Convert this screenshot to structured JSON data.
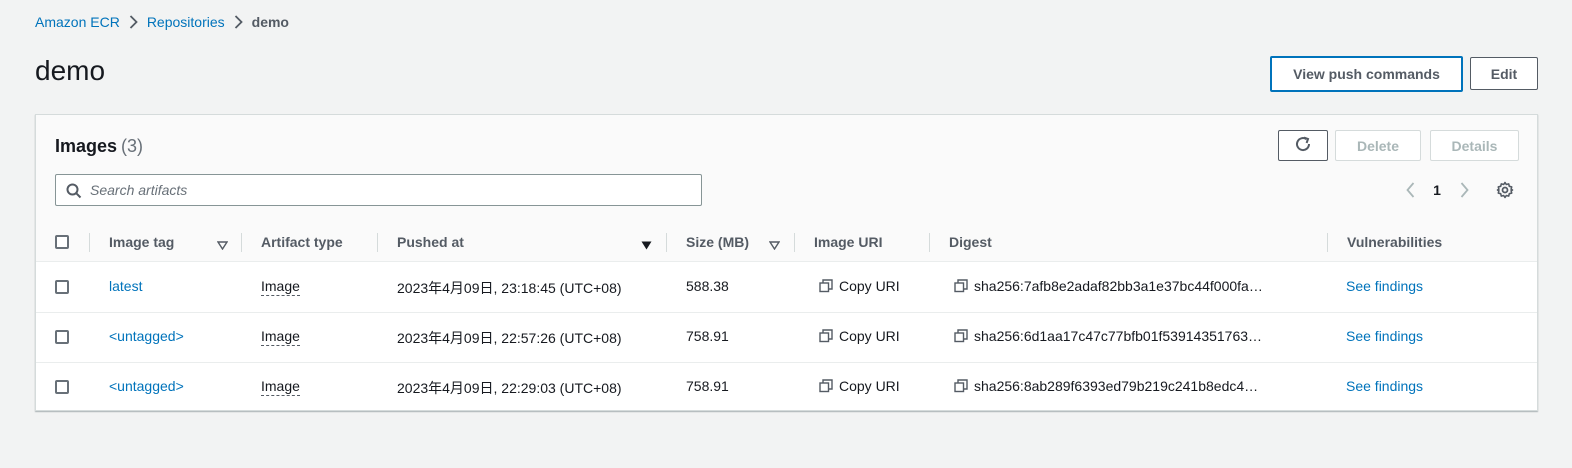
{
  "breadcrumb": {
    "items": [
      "Amazon ECR",
      "Repositories"
    ],
    "current": "demo"
  },
  "page": {
    "title": "demo"
  },
  "header_actions": {
    "view_push_commands": "View push commands",
    "edit": "Edit"
  },
  "images_panel": {
    "title": "Images",
    "count": "(3)",
    "delete_label": "Delete",
    "details_label": "Details",
    "search_placeholder": "Search artifacts",
    "current_page": "1"
  },
  "table": {
    "columns": [
      "Image tag",
      "Artifact type",
      "Pushed at",
      "Size (MB)",
      "Image URI",
      "Digest",
      "Vulnerabilities"
    ],
    "rows": [
      {
        "tag": "latest",
        "artifact_type": "Image",
        "pushed_at": "2023年4月09日, 23:18:45 (UTC+08)",
        "size": "588.38",
        "image_uri": "Copy URI",
        "digest": "sha256:7afb8e2adaf82bb3a1e37bc44f000fa…",
        "vulnerabilities": "See findings"
      },
      {
        "tag": "<untagged>",
        "artifact_type": "Image",
        "pushed_at": "2023年4月09日, 22:57:26 (UTC+08)",
        "size": "758.91",
        "image_uri": "Copy URI",
        "digest": "sha256:6d1aa17c47c77bfb01f53914351763…",
        "vulnerabilities": "See findings"
      },
      {
        "tag": "<untagged>",
        "artifact_type": "Image",
        "pushed_at": "2023年4月09日, 22:29:03 (UTC+08)",
        "size": "758.91",
        "image_uri": "Copy URI",
        "digest": "sha256:8ab289f6393ed79b219c241b8edc4…",
        "vulnerabilities": "See findings"
      }
    ]
  },
  "colors": {
    "link": "#0073bb",
    "background": "#f2f3f3",
    "text": "#16191f",
    "muted": "#545b64"
  },
  "icons": [
    "chevron-right-icon",
    "refresh-icon",
    "search-icon",
    "chevron-left-icon",
    "settings-icon",
    "sort-icon",
    "copy-icon"
  ]
}
